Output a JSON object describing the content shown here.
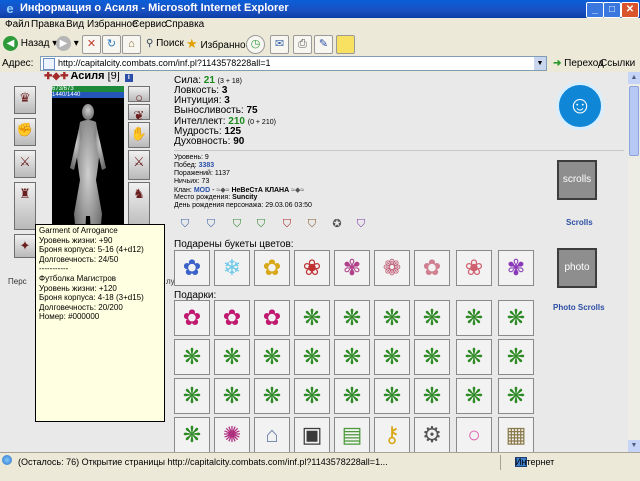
{
  "window": {
    "title": "Информация о Асиля - Microsoft Internet Explorer",
    "min_glyph": "_",
    "max_glyph": "□",
    "close_glyph": "✕"
  },
  "menu": [
    "Файл",
    "Правка",
    "Вид",
    "Избранное",
    "Сервис",
    "Справка"
  ],
  "toolbar": {
    "back_label": "Назад",
    "search_label": "Поиск",
    "favorites_label": "Избранное"
  },
  "address": {
    "label": "Адрес:",
    "url": "http://capitalcity.combats.com/inf.pl?1143578228all=1",
    "go_label": "Переход",
    "links_label": "Ссылки"
  },
  "character": {
    "name": "Асиля",
    "level": "[9]",
    "hp": "673/673",
    "mp": "1440/1440",
    "caption": "Перс",
    "caption_right": "лубе."
  },
  "tooltip": [
    "Garment of Arrogance",
    "Уровень жизни: +90",
    "Броня корпуса: 5-16 (4+d12)",
    "Долговечность: 24/50",
    "-----------",
    "Футболка Магистров",
    "Уровень жизни: +120",
    "Броня корпуса: 4-18 (3+d15)",
    "Долговечность: 20/200",
    "Номер: #000000"
  ],
  "stats": [
    {
      "label": "Сила:",
      "value": "21",
      "detail": "(3 + 18)",
      "highlight": true
    },
    {
      "label": "Ловкость:",
      "value": "3",
      "detail": "",
      "highlight": false
    },
    {
      "label": "Интуиция:",
      "value": "3",
      "detail": "",
      "highlight": false
    },
    {
      "label": "Выносливость:",
      "value": "75",
      "detail": "",
      "highlight": false
    },
    {
      "label": "Интеллект:",
      "value": "210",
      "detail": "(0 + 210)",
      "highlight": true
    },
    {
      "label": "Мудрость:",
      "value": "125",
      "detail": "",
      "highlight": false
    },
    {
      "label": "Духовность:",
      "value": "90",
      "detail": "",
      "highlight": false
    }
  ],
  "info": {
    "level": "Уровень: 9",
    "wins_label": "Побед:",
    "wins": "3383",
    "losses": "Поражений: 1137",
    "draws": "Ничьих: 73",
    "clan_label": "Клан:",
    "clan_role": "MOD",
    "clan_name": "НеВеСтА КЛАНА",
    "birthplace_label": "Место рождения:",
    "birthplace": "Suncity",
    "birthday": "День рождения персонажа: 29.03.06 03:50"
  },
  "sections": {
    "bouquets": "Подарены букеты цветов:",
    "gifts": "Подарки:"
  },
  "side": {
    "scrolls_label": "Scrolls",
    "scrolls_icon_text": "scrolls",
    "photo_label": "Photo Scrolls",
    "photo_icon_text": "photo"
  },
  "status": {
    "text": "(Осталось: 76) Открытие страницы http://capitalcity.combats.com/inf.pl?1143578228all=1...",
    "zone": "Интернет"
  }
}
